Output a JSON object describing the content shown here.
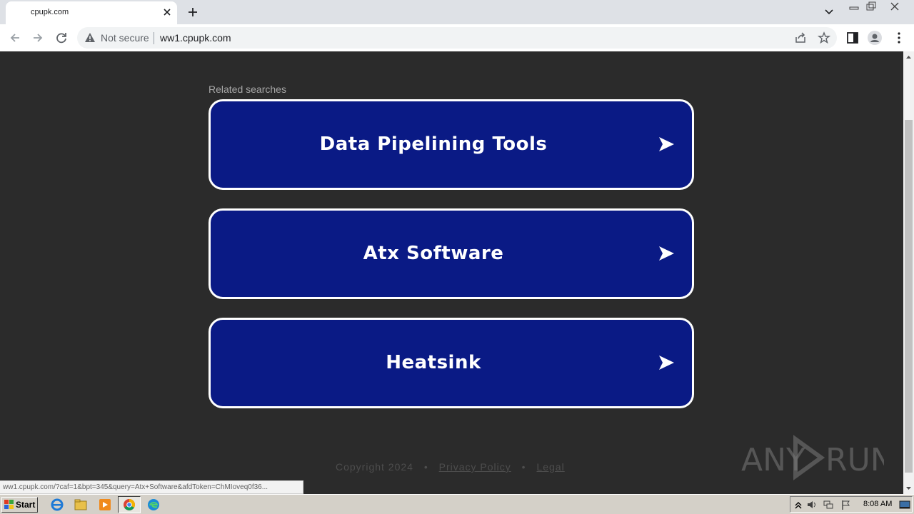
{
  "browser": {
    "tab": {
      "title": "cpupk.com"
    },
    "address": {
      "security_label": "Not secure",
      "url": "ww1.cpupk.com"
    }
  },
  "page": {
    "related_label": "Related searches",
    "results": [
      {
        "label": "Data Pipelining Tools"
      },
      {
        "label": "Atx Software"
      },
      {
        "label": "Heatsink"
      }
    ],
    "footer": {
      "copyright": "Copyright 2024",
      "separator": "•",
      "privacy": "Privacy Policy",
      "legal": "Legal"
    },
    "watermark": "ANY RUN"
  },
  "status_bar": {
    "url": "ww1.cpupk.com/?caf=1&bpt=345&query=Atx+Software&afdToken=ChMIoveq0f36..."
  },
  "taskbar": {
    "start_label": "Start",
    "clock": "8:08 AM",
    "apps": [
      "ie-icon",
      "explorer-icon",
      "media-player-icon",
      "chrome-icon",
      "edge-icon"
    ]
  },
  "colors": {
    "page_background": "#2b2b2b",
    "result_button": "#0a1a85",
    "result_border": "#ffffff"
  }
}
